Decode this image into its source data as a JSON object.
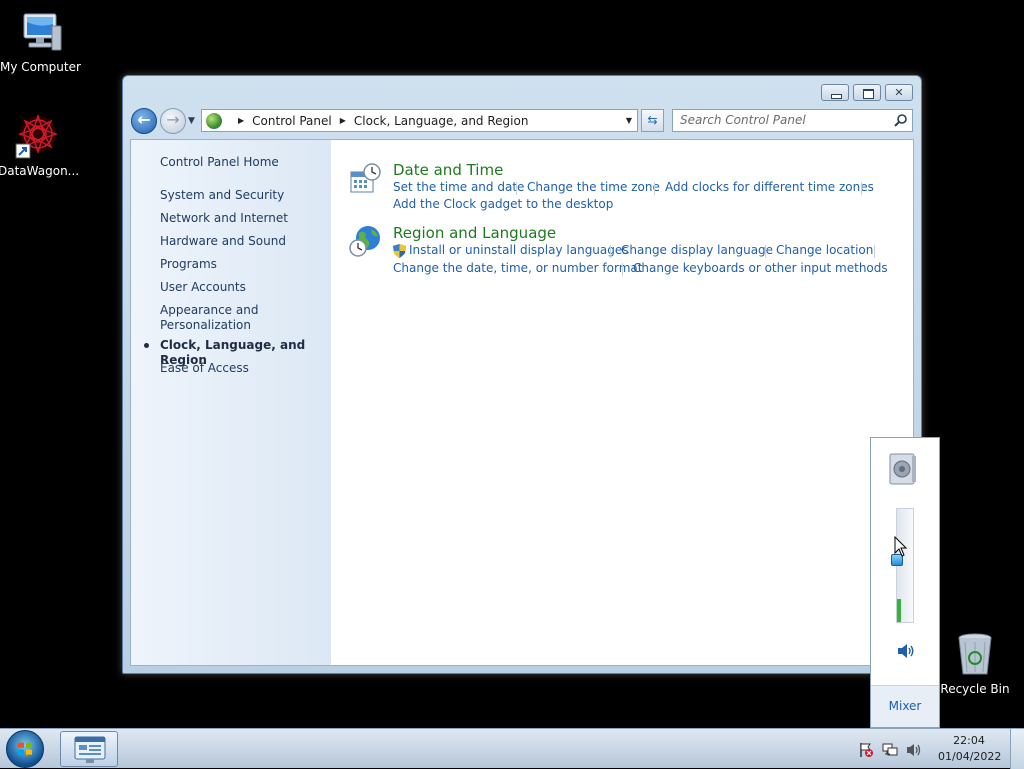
{
  "desktop": {
    "icons": [
      {
        "label": "My Computer",
        "icon": "computer-icon"
      },
      {
        "label": "DataWagon...",
        "icon": "app-shortcut-icon"
      },
      {
        "label": "Recycle Bin",
        "icon": "recycle-bin-icon"
      }
    ]
  },
  "window": {
    "address": {
      "crumbs": [
        "Control Panel",
        "Clock, Language, and Region"
      ]
    },
    "search": {
      "placeholder": "Search Control Panel"
    },
    "sidebar": {
      "home": "Control Panel Home",
      "items": [
        "System and Security",
        "Network and Internet",
        "Hardware and Sound",
        "Programs",
        "User Accounts",
        "Appearance and Personalization",
        "Clock, Language, and Region",
        "Ease of Access"
      ],
      "current_index": 6
    },
    "categories": [
      {
        "title": "Date and Time",
        "icon": "calendar-clock-icon",
        "links": [
          "Set the time and date",
          "Change the time zone",
          "Add clocks for different time zones",
          "Add the Clock gadget to the desktop"
        ]
      },
      {
        "title": "Region and Language",
        "icon": "globe-clock-icon",
        "links": [
          "Install or uninstall display languages",
          "Change display language",
          "Change location",
          "Change the date, time, or number format",
          "Change keyboards or other input methods"
        ]
      }
    ]
  },
  "volume": {
    "mixer_label": "Mixer",
    "level": 0.2
  },
  "taskbar": {
    "time": "22:04",
    "date": "01/04/2022"
  },
  "colors": {
    "link": "#1f5fae",
    "category_title": "#1e7a1e",
    "volume_fill": "#35b435"
  }
}
